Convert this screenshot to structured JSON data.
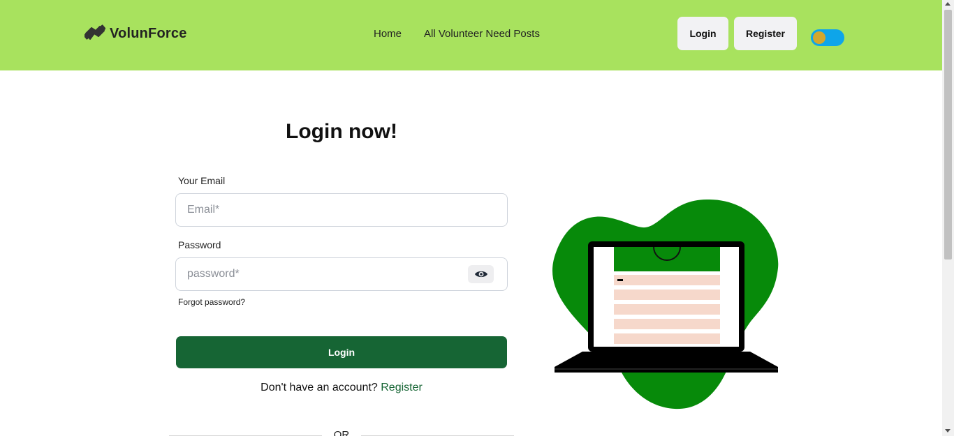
{
  "header": {
    "brand": "VolunForce",
    "nav_links": [
      "Home",
      "All Volunteer Need Posts"
    ],
    "login_label": "Login",
    "register_label": "Register"
  },
  "form": {
    "title": "Login now!",
    "email_label": "Your Email",
    "email_placeholder": "Email*",
    "password_label": "Password",
    "password_placeholder": "password*",
    "forgot_label": "Forgot password?",
    "submit_label": "Login",
    "signup_prompt": "Don't have an account?",
    "signup_link": "Register",
    "divider_text": "OR"
  },
  "icons": {
    "brand": "handshake-icon",
    "password_toggle": "eye-icon",
    "theme_toggle": "theme-toggle"
  },
  "colors": {
    "header_bg": "#a8e25e",
    "primary": "#166534",
    "illustration_blob": "#078a0a",
    "toggle_track": "#0ea5e9",
    "toggle_knob": "#d4a72c",
    "screen_rows": "#f6d8cb"
  }
}
